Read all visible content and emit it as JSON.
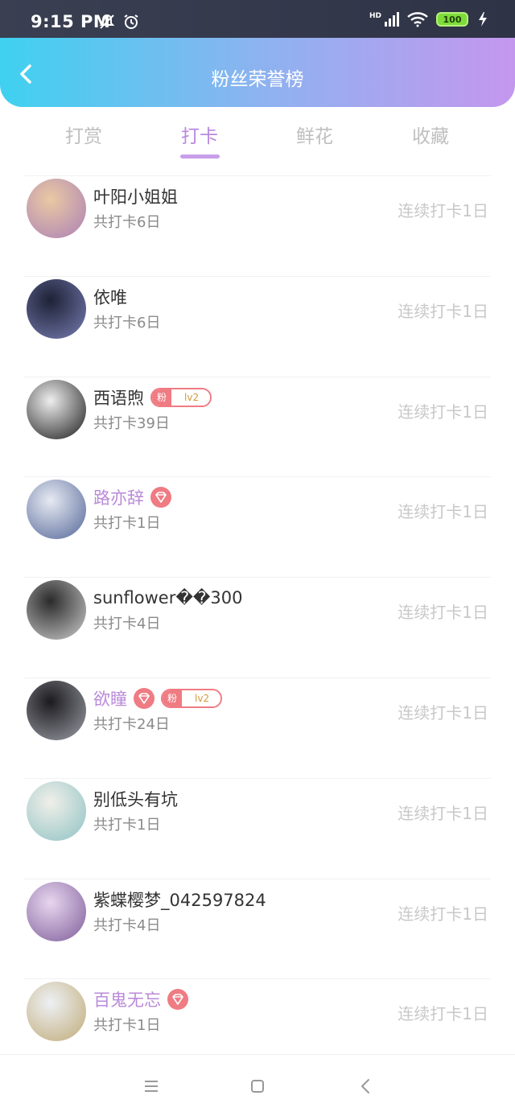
{
  "status": {
    "time": "9:15 PM",
    "battery": "100",
    "network": "HD"
  },
  "header": {
    "title": "粉丝荣誉榜"
  },
  "tabs": [
    {
      "label": "打赏",
      "active": false
    },
    {
      "label": "打卡",
      "active": true
    },
    {
      "label": "鲜花",
      "active": false
    },
    {
      "label": "收藏",
      "active": false
    }
  ],
  "fans": [
    {
      "name": "叶阳小姐姐",
      "total": "共打卡6日",
      "streak": "连续打卡1日",
      "vip": false,
      "diamond": false,
      "fan_badge": null,
      "avatar_colors": [
        "#e9c9a3",
        "#b58bb3"
      ]
    },
    {
      "name": "依唯",
      "total": "共打卡6日",
      "streak": "连续打卡1日",
      "vip": false,
      "diamond": false,
      "fan_badge": null,
      "avatar_colors": [
        "#1d2236",
        "#6a6fa0"
      ]
    },
    {
      "name": "西语煦",
      "total": "共打卡39日",
      "streak": "连续打卡1日",
      "vip": false,
      "diamond": false,
      "fan_badge": {
        "tag": "粉",
        "level": "lv2"
      },
      "avatar_colors": [
        "#eeeeee",
        "#3b3b3b"
      ]
    },
    {
      "name": "路亦辞",
      "total": "共打卡1日",
      "streak": "连续打卡1日",
      "vip": true,
      "diamond": true,
      "fan_badge": null,
      "avatar_colors": [
        "#e6eaf2",
        "#6a7aa6"
      ]
    },
    {
      "name": "sunflower��300",
      "total": "共打卡4日",
      "streak": "连续打卡1日",
      "vip": false,
      "diamond": false,
      "fan_badge": null,
      "avatar_colors": [
        "#2b2b2b",
        "#b5b5b5"
      ]
    },
    {
      "name": "欲瞳",
      "total": "共打卡24日",
      "streak": "连续打卡1日",
      "vip": true,
      "diamond": true,
      "fan_badge": {
        "tag": "粉",
        "level": "lv2"
      },
      "avatar_colors": [
        "#1b1b1f",
        "#8a8a93"
      ]
    },
    {
      "name": "别低头有坑",
      "total": "共打卡1日",
      "streak": "连续打卡1日",
      "vip": false,
      "diamond": false,
      "fan_badge": null,
      "avatar_colors": [
        "#f1efe9",
        "#9cc9c9"
      ]
    },
    {
      "name": "紫蝶樱梦_042597824",
      "total": "共打卡4日",
      "streak": "连续打卡1日",
      "vip": false,
      "diamond": false,
      "fan_badge": null,
      "avatar_colors": [
        "#e7d6ef",
        "#8e6fa6"
      ]
    },
    {
      "name": "百鬼无忘",
      "total": "共打卡1日",
      "streak": "连续打卡1日",
      "vip": true,
      "diamond": true,
      "fan_badge": null,
      "avatar_colors": [
        "#edf0f4",
        "#c7b58a"
      ]
    }
  ]
}
